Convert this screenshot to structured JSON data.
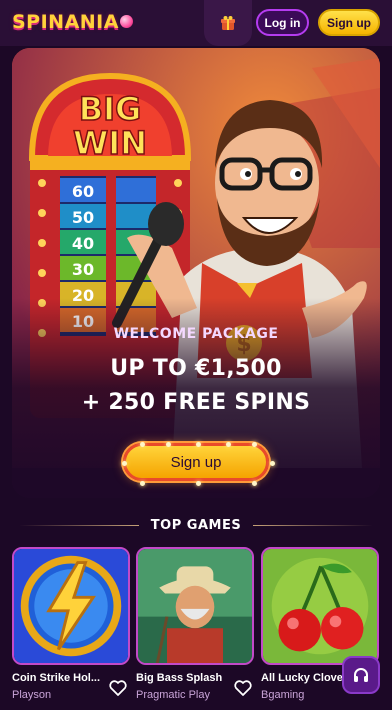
{
  "header": {
    "logo": "SPINANIA",
    "login_label": "Log in",
    "signup_label": "Sign up"
  },
  "banner": {
    "sign_text": [
      "BIG",
      "WIN"
    ],
    "meter_values": [
      "60",
      "50",
      "40",
      "30",
      "20",
      "10"
    ],
    "subtitle": "WELCOME PACKAGE",
    "line1": "UP TO €1,500",
    "line2": "+ 250 FREE SPINS",
    "cta_label": "Sign up"
  },
  "top_games": {
    "title": "TOP GAMES",
    "games": [
      {
        "title": "Coin Strike Hol...",
        "provider": "Playson"
      },
      {
        "title": "Big Bass Splash",
        "provider": "Pragmatic Play"
      },
      {
        "title": "All Lucky Clove",
        "provider": "Bgaming"
      }
    ]
  },
  "colors": {
    "background": "#1c0826",
    "accent_yellow": "#ffd23a",
    "accent_purple": "#b53cf0",
    "card_border": "#c24ac8"
  },
  "icons": [
    "gift-icon",
    "heart-icon",
    "headphones-icon"
  ]
}
